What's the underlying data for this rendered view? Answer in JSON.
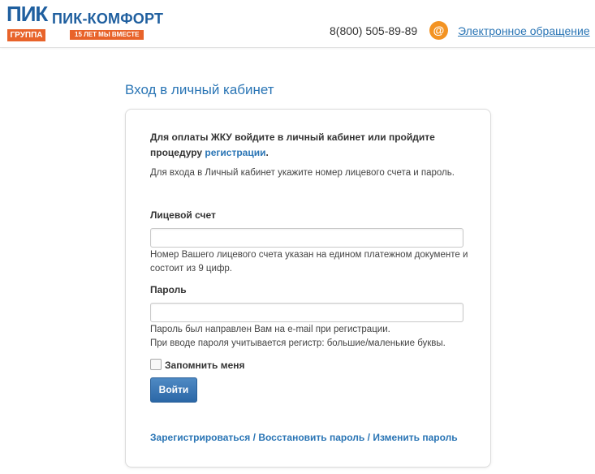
{
  "header": {
    "logo_top": "ПИК",
    "logo_band": "ГРУППА",
    "brand_title": "ПИК-КОМФОРТ",
    "brand_badge": "15 ЛЕТ МЫ ВМЕСТЕ",
    "phone": "8(800) 505-89-89",
    "appeal_icon_symbol": "@",
    "appeal_link": "Электронное обращение"
  },
  "page": {
    "title": "Вход в личный кабинет",
    "intro_text": "Для оплаты ЖКУ войдите в личный кабинет или пройдите процедуру ",
    "intro_link": "регистрации",
    "intro_end": ".",
    "hint": "Для входа в Личный кабинет укажите номер лицевого счета и пароль."
  },
  "form": {
    "account_label": "Лицевой счет",
    "account_value": "",
    "account_help": "Номер Вашего лицевого счета указан на едином платежном документе и состоит из 9 цифр.",
    "password_label": "Пароль",
    "password_value": "",
    "password_help_1": "Пароль был направлен Вам на e-mail при регистрации.",
    "password_help_2": "При вводе пароля учитывается регистр: большие/маленькие буквы.",
    "remember_label": "Запомнить меня",
    "remember_checked": false,
    "login_button": "Войти"
  },
  "links": {
    "register": "Зарегистрироваться",
    "restore": "Восстановить пароль",
    "change": "Изменить пароль",
    "separator": "/"
  },
  "colors": {
    "brand_blue": "#1f5f9f",
    "link_blue": "#2a75b5",
    "accent_orange": "#e8632a",
    "icon_orange": "#f39323"
  }
}
